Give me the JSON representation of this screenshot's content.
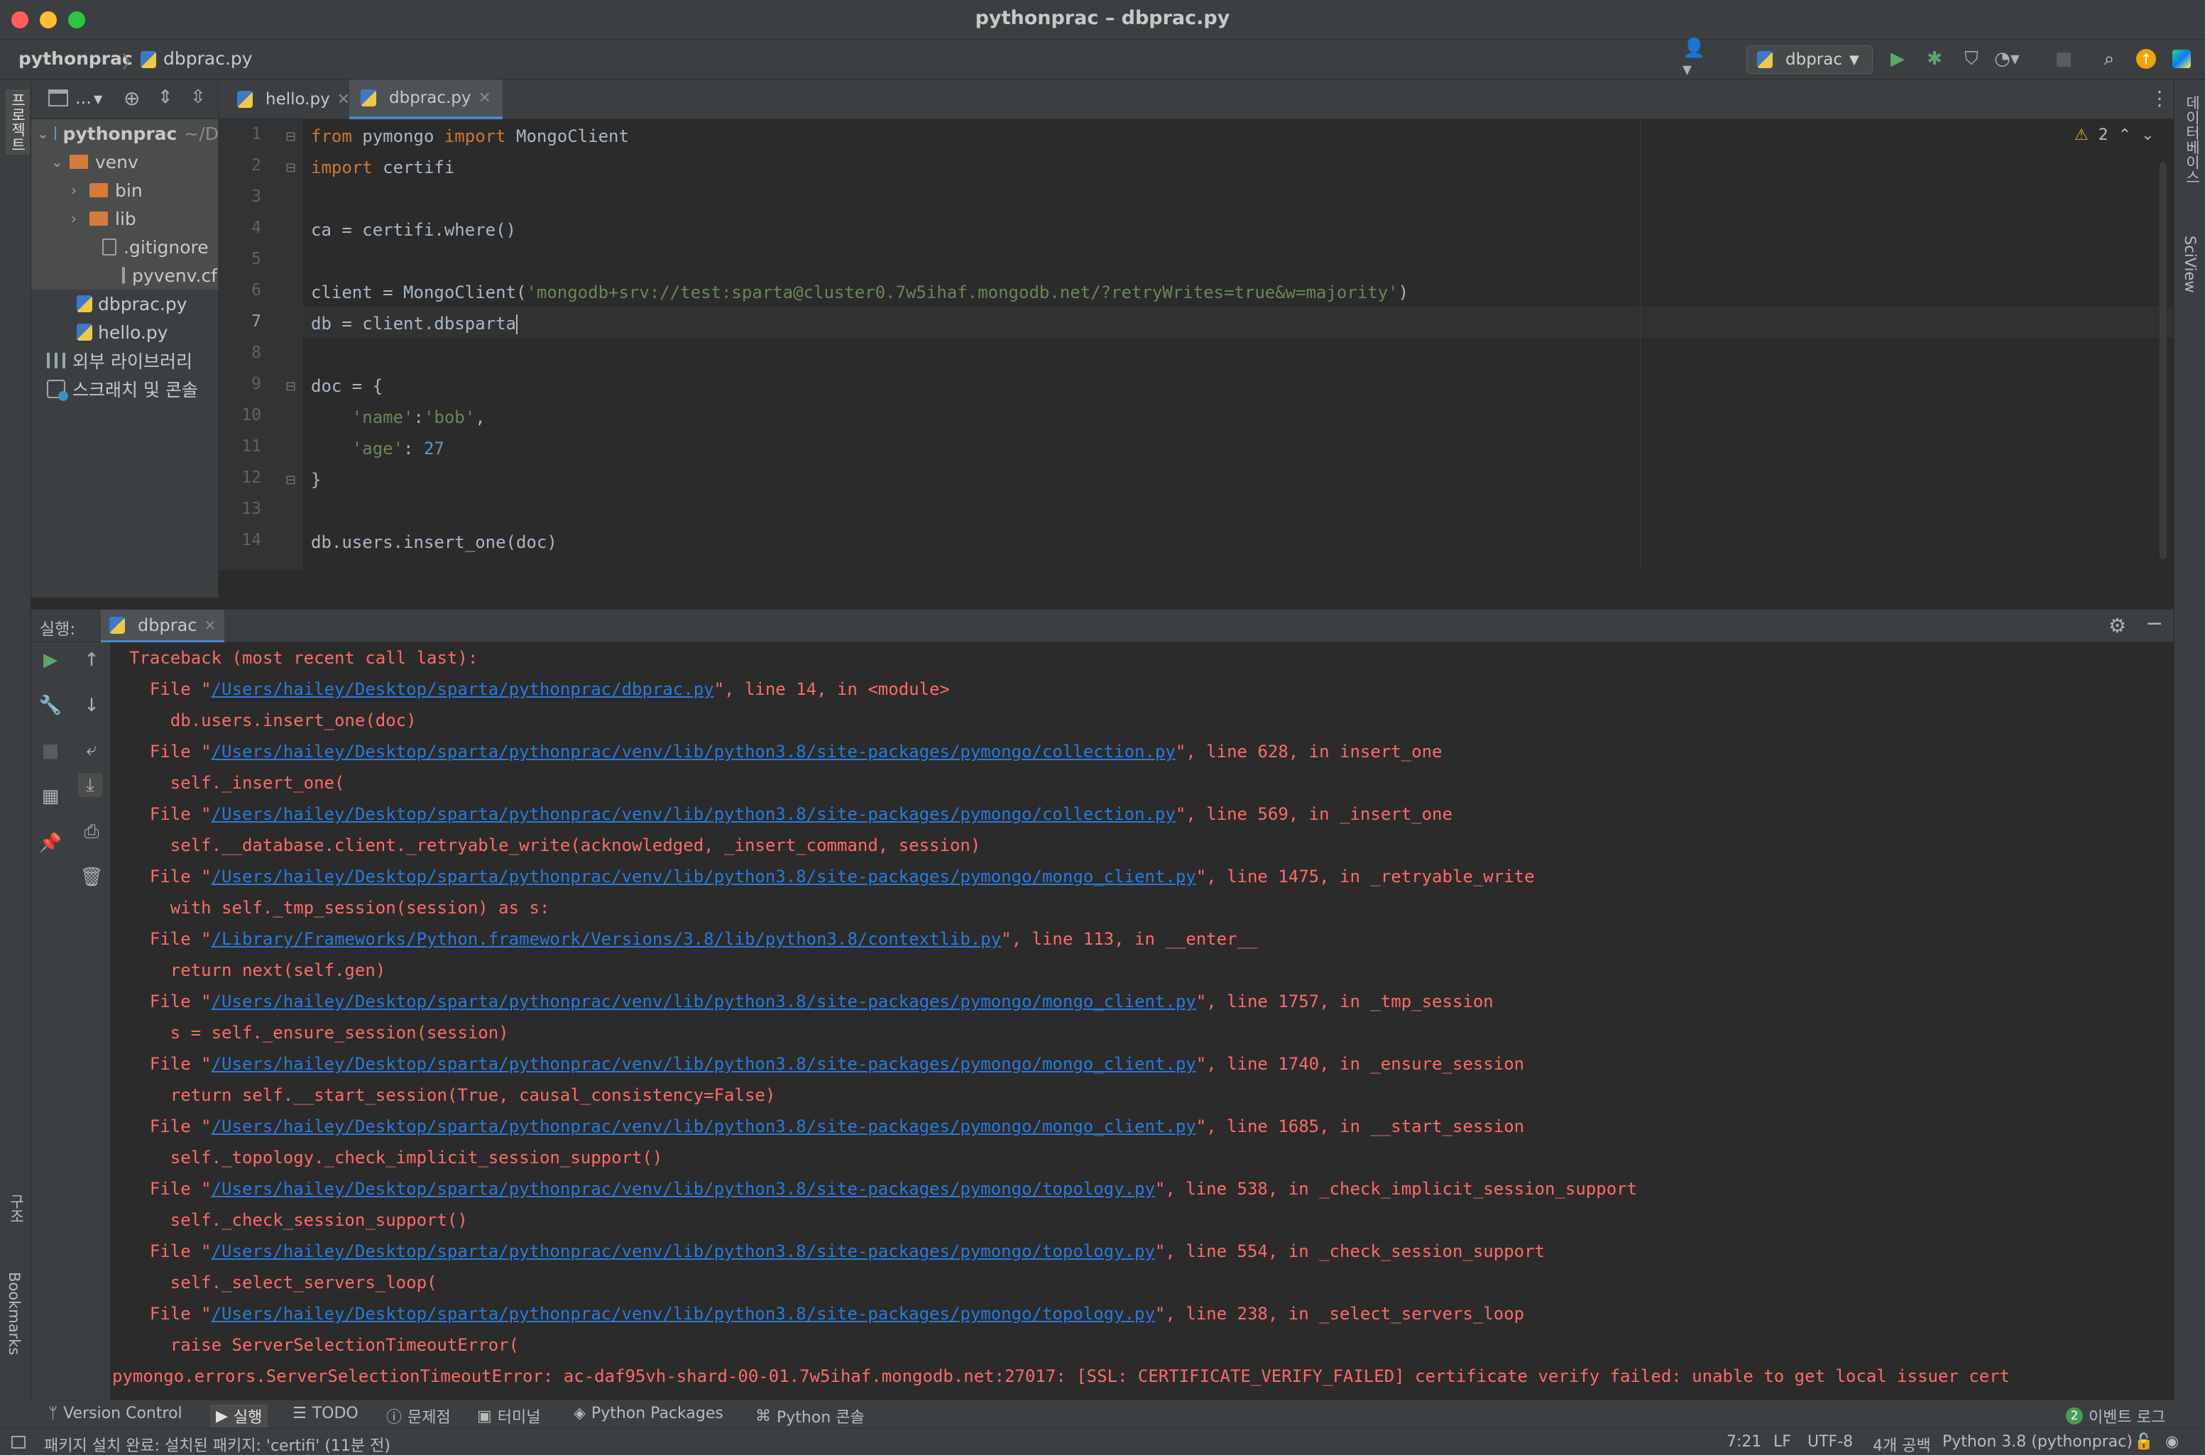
{
  "window": {
    "title": "pythonprac – dbprac.py"
  },
  "breadcrumb": {
    "project": "pythonprac",
    "file": "dbprac.py"
  },
  "toolbar": {
    "run_config": "dbprac"
  },
  "left_strip": {
    "project_label": "프로젝트",
    "structure_label": "구조",
    "bookmarks_label": "Bookmarks"
  },
  "right_strip": {
    "database_label": "데이터베이스",
    "sciview_label": "SciView"
  },
  "project_toolbar": {
    "title": "..."
  },
  "tree": {
    "root": "pythonprac",
    "root_path": "~/D",
    "venv": "venv",
    "bin": "bin",
    "lib": "lib",
    "gitignore": ".gitignore",
    "pyvenv": "pyvenv.cfg",
    "dbprac": "dbprac.py",
    "hello": "hello.py",
    "external_libs": "외부 라이브러리",
    "scratches": "스크래치 및 콘솔"
  },
  "tabs": [
    {
      "label": "hello.py"
    },
    {
      "label": "dbprac.py"
    }
  ],
  "inspections": {
    "warning_count": "2"
  },
  "code": {
    "l1_a": "from",
    "l1_b": " pymongo ",
    "l1_c": "import",
    "l1_d": " MongoClient",
    "l2_a": "import",
    "l2_b": " certifi",
    "l4": "ca = certifi.where()",
    "l6_a": "client = MongoClient(",
    "l6_b": "'mongodb+srv://test:sparta@cluster0.7w5ihaf.mongodb.net/?retryWrites=true&w=majority'",
    "l6_c": ")",
    "l7": "db = client.dbsparta",
    "l9": "doc = {",
    "l10_a": "    ",
    "l10_b": "'name'",
    "l10_c": ":",
    "l10_d": "'bob'",
    "l10_e": ",",
    "l11_a": "    ",
    "l11_b": "'age'",
    "l11_c": ": ",
    "l11_d": "27",
    "l12": "}",
    "l14": "db.users.insert_one(doc)"
  },
  "line_numbers": [
    "1",
    "2",
    "3",
    "4",
    "5",
    "6",
    "7",
    "8",
    "9",
    "10",
    "11",
    "12",
    "13",
    "14"
  ],
  "run_panel": {
    "label": "실행:",
    "tab": "dbprac"
  },
  "console": {
    "c0": "Traceback (most recent call last):",
    "f_pre": "  File \"",
    "p1": "/Users/hailey/Desktop/sparta/pythonprac/dbprac.py",
    "s1": "\", line 14, in <module>",
    "c2": "    db.users.insert_one(doc)",
    "p2": "/Users/hailey/Desktop/sparta/pythonprac/venv/lib/python3.8/site-packages/pymongo/collection.py",
    "s2": "\", line 628, in insert_one",
    "c4": "    self._insert_one(",
    "p3": "/Users/hailey/Desktop/sparta/pythonprac/venv/lib/python3.8/site-packages/pymongo/collection.py",
    "s3": "\", line 569, in _insert_one",
    "c6": "    self.__database.client._retryable_write(acknowledged, _insert_command, session)",
    "p4": "/Users/hailey/Desktop/sparta/pythonprac/venv/lib/python3.8/site-packages/pymongo/mongo_client.py",
    "s4": "\", line 1475, in _retryable_write",
    "c8": "    with self._tmp_session(session) as s:",
    "p5": "/Library/Frameworks/Python.framework/Versions/3.8/lib/python3.8/contextlib.py",
    "s5": "\", line 113, in __enter__",
    "c10": "    return next(self.gen)",
    "p6": "/Users/hailey/Desktop/sparta/pythonprac/venv/lib/python3.8/site-packages/pymongo/mongo_client.py",
    "s6": "\", line 1757, in _tmp_session",
    "c12": "    s = self._ensure_session(session)",
    "p7": "/Users/hailey/Desktop/sparta/pythonprac/venv/lib/python3.8/site-packages/pymongo/mongo_client.py",
    "s7": "\", line 1740, in _ensure_session",
    "c14": "    return self.__start_session(True, causal_consistency=False)",
    "p8": "/Users/hailey/Desktop/sparta/pythonprac/venv/lib/python3.8/site-packages/pymongo/mongo_client.py",
    "s8": "\", line 1685, in __start_session",
    "c16": "    self._topology._check_implicit_session_support()",
    "p9": "/Users/hailey/Desktop/sparta/pythonprac/venv/lib/python3.8/site-packages/pymongo/topology.py",
    "s9": "\", line 538, in _check_implicit_session_support",
    "c18": "    self._check_session_support()",
    "p10": "/Users/hailey/Desktop/sparta/pythonprac/venv/lib/python3.8/site-packages/pymongo/topology.py",
    "s10": "\", line 554, in _check_session_support",
    "c20": "    self._select_servers_loop(",
    "p11": "/Users/hailey/Desktop/sparta/pythonprac/venv/lib/python3.8/site-packages/pymongo/topology.py",
    "s11": "\", line 238, in _select_servers_loop",
    "c22": "    raise ServerSelectionTimeoutError(",
    "c23": "pymongo.errors.ServerSelectionTimeoutError: ac-daf95vh-shard-00-01.7w5ihaf.mongodb.net:27017: [SSL: CERTIFICATE_VERIFY_FAILED] certificate verify failed: unable to get local issuer cert"
  },
  "bottom_tabs": {
    "vcs": "Version Control",
    "run": "실행",
    "todo": "TODO",
    "problems": "문제점",
    "terminal": "터미널",
    "packages": "Python Packages",
    "pyconsole": "Python 콘솔",
    "events_count": "2",
    "events": "이벤트 로그"
  },
  "status": {
    "message": "패키지 설치 완료: 설치된 패키지: 'certifi' (11분 전)",
    "position": "7:21",
    "line_sep": "LF",
    "encoding": "UTF-8",
    "indent": "4개 공백",
    "interpreter": "Python 3.8 (pythonprac)"
  },
  "colors": {
    "accent": "#4a88c7",
    "error": "#ff6b68",
    "link": "#287bde",
    "keyword": "#cc7832",
    "string": "#6a8759",
    "number": "#6897bb"
  }
}
